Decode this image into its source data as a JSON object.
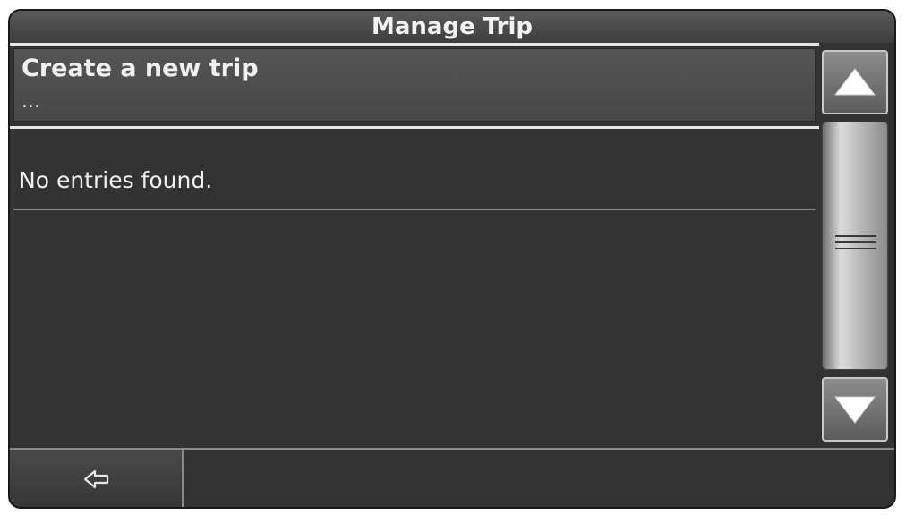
{
  "window": {
    "title": "Manage Trip"
  },
  "list": {
    "items": [
      {
        "label": "Create a new trip",
        "sublabel": "..."
      }
    ],
    "empty_message": "No entries found."
  },
  "scrollbar": {
    "up_icon": "triangle-up-icon",
    "down_icon": "triangle-down-icon",
    "grip_icon": "grip-lines-icon"
  },
  "footer": {
    "back_icon": "back-arrow-icon"
  },
  "colors": {
    "background": "#333333",
    "title_text": "#f2f2f2",
    "divider": "#e6e6e6"
  }
}
